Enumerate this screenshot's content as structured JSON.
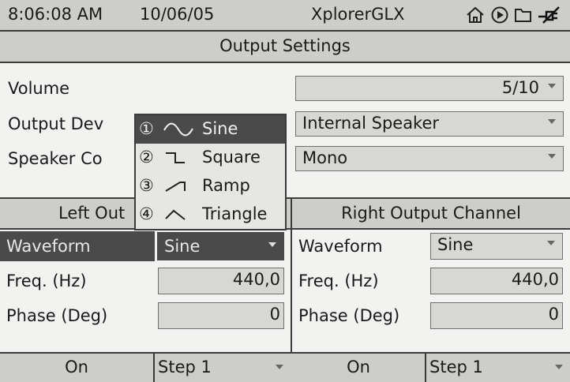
{
  "status_bar": {
    "time": "8:06:08 AM",
    "date": "10/06/05",
    "device": "XplorerGLX",
    "icons": [
      "home-icon",
      "play-icon",
      "folder-icon",
      "power-plug-icon"
    ]
  },
  "title": "Output Settings",
  "settings": {
    "volume": {
      "label": "Volume",
      "value": "5/10"
    },
    "output_device": {
      "label": "Output Dev",
      "value": "Internal Speaker"
    },
    "speaker_config": {
      "label": "Speaker Co",
      "value": "Mono"
    }
  },
  "left_channel": {
    "header": "Left Out",
    "waveform": {
      "label": "Waveform",
      "value": "Sine"
    },
    "freq": {
      "label": "Freq. (Hz)",
      "value": "440,0"
    },
    "phase": {
      "label": "Phase (Deg)",
      "value": "0"
    },
    "toggle": "On",
    "step": "Step 1"
  },
  "right_channel": {
    "header": "Right Output Channel",
    "waveform": {
      "label": "Waveform",
      "value": "Sine"
    },
    "freq": {
      "label": "Freq. (Hz)",
      "value": "440,0"
    },
    "phase": {
      "label": "Phase (Deg)",
      "value": "0"
    },
    "toggle": "On",
    "step": "Step 1"
  },
  "waveform_menu": {
    "items": [
      {
        "num": "①",
        "icon": "sine-wave-icon",
        "label": "Sine",
        "selected": true
      },
      {
        "num": "②",
        "icon": "square-wave-icon",
        "label": "Square",
        "selected": false
      },
      {
        "num": "③",
        "icon": "ramp-wave-icon",
        "label": "Ramp",
        "selected": false
      },
      {
        "num": "④",
        "icon": "triangle-wave-icon",
        "label": "Triangle",
        "selected": false
      }
    ]
  }
}
